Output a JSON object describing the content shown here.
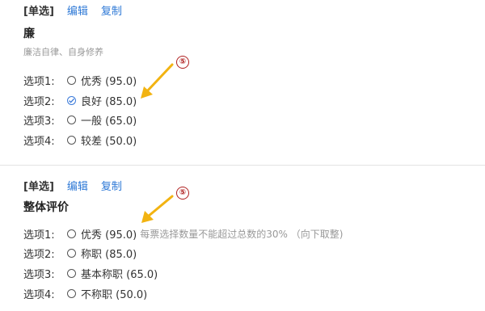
{
  "questions": [
    {
      "type_tag": "[单选]",
      "edit_label": "编辑",
      "copy_label": "复制",
      "title": "廉",
      "description": "廉洁自律、自身修养",
      "options": [
        {
          "label": "选项1:",
          "text": "优秀 (95.0)",
          "checked": false
        },
        {
          "label": "选项2:",
          "text": "良好 (85.0)",
          "checked": true
        },
        {
          "label": "选项3:",
          "text": "一般 (65.0)",
          "checked": false
        },
        {
          "label": "选项4:",
          "text": "较差 (50.0)",
          "checked": false
        }
      ],
      "marker": "⑤"
    },
    {
      "type_tag": "[单选]",
      "edit_label": "编辑",
      "copy_label": "复制",
      "title": "整体评价",
      "options": [
        {
          "label": "选项1:",
          "text": "优秀 (95.0)",
          "hint": "每票选择数量不能超过总数的30% （向下取整)",
          "checked": false
        },
        {
          "label": "选项2:",
          "text": "称职 (85.0)",
          "checked": false
        },
        {
          "label": "选项3:",
          "text": "基本称职 (65.0)",
          "checked": false
        },
        {
          "label": "选项4:",
          "text": "不称职 (50.0)",
          "checked": false
        }
      ],
      "marker": "⑤"
    }
  ],
  "colors": {
    "link": "#2d78d6",
    "arrow": "#f2b311",
    "marker": "#b02020",
    "hint": "#999999"
  }
}
